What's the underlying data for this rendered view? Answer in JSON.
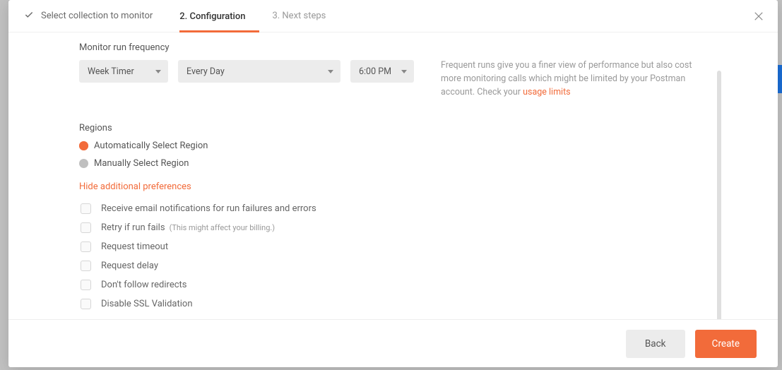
{
  "steps": {
    "step1": "Select collection to monitor",
    "step2": "2. Configuration",
    "step3": "3. Next steps"
  },
  "frequency": {
    "label": "Monitor run frequency",
    "timer": "Week Timer",
    "day": "Every Day",
    "time": "6:00 PM",
    "hint_a": "Frequent runs give you a finer view of performance but also cost more monitoring calls which might be limited by your Postman account. Check your ",
    "hint_link": "usage limits"
  },
  "regions": {
    "label": "Regions",
    "auto": "Automatically Select Region",
    "manual": "Manually Select Region"
  },
  "toggle": "Hide additional preferences",
  "prefs": {
    "email": "Receive email notifications for run failures and errors",
    "retry": "Retry if run fails",
    "retry_sub": "(This might affect your billing.)",
    "timeout": "Request timeout",
    "delay": "Request delay",
    "redirects": "Don't follow redirects",
    "ssl": "Disable SSL Validation"
  },
  "footer": {
    "back": "Back",
    "create": "Create"
  }
}
